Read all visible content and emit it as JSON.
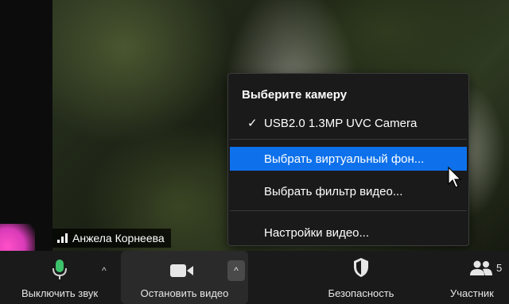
{
  "participant": {
    "name": "Анжела Корнеева"
  },
  "camera_menu": {
    "header": "Выберите камеру",
    "check_glyph": "✓",
    "camera_option": "USB2.0 1.3MP UVC Camera",
    "virtual_background": "Выбрать виртуальный фон...",
    "video_filter": "Выбрать фильтр видео...",
    "video_settings": "Настройки видео..."
  },
  "toolbar": {
    "mute_label": "Выключить звук",
    "video_label": "Остановить видео",
    "security_label": "Безопасность",
    "participants_label": "Участник",
    "participants_count": "5",
    "caret": "^"
  },
  "colors": {
    "menu_highlight": "#0e71eb",
    "toolbar_bg": "#1a1a1a",
    "mic_icon": "#3ec26b"
  },
  "icons": [
    "signal-icon",
    "check-icon",
    "cursor-icon",
    "microphone-icon",
    "camera-icon",
    "shield-icon",
    "participants-icon",
    "caret-up-icon"
  ]
}
